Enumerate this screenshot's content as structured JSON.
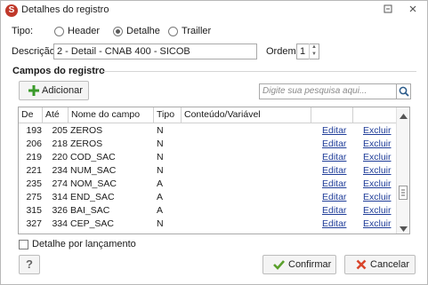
{
  "window": {
    "title": "Detalhes do registro",
    "app_icon_glyph": "S"
  },
  "tipo": {
    "label": "Tipo:",
    "options": [
      "Header",
      "Detalhe",
      "Trailler"
    ],
    "selected": "Detalhe"
  },
  "descricao": {
    "label": "Descrição:",
    "value": "2 - Detail - CNAB 400 - SICOB"
  },
  "ordem": {
    "label": "Ordem:",
    "value": "1"
  },
  "campos": {
    "title": "Campos do registro",
    "add_button": "Adicionar",
    "search_placeholder": "Digite sua pesquisa aqui...",
    "columns": [
      "De",
      "Até",
      "Nome do campo",
      "Tipo",
      "Conteúdo/Variável"
    ],
    "rows": [
      {
        "de": "193",
        "ate": "205",
        "nome": "ZEROS",
        "tipo": "N",
        "conteudo": "",
        "edit": "Editar",
        "delete": "Excluir"
      },
      {
        "de": "206",
        "ate": "218",
        "nome": "ZEROS",
        "tipo": "N",
        "conteudo": "",
        "edit": "Editar",
        "delete": "Excluir"
      },
      {
        "de": "219",
        "ate": "220",
        "nome": "COD_SAC",
        "tipo": "N",
        "conteudo": "",
        "edit": "Editar",
        "delete": "Excluir"
      },
      {
        "de": "221",
        "ate": "234",
        "nome": "NUM_SAC",
        "tipo": "N",
        "conteudo": "",
        "edit": "Editar",
        "delete": "Excluir"
      },
      {
        "de": "235",
        "ate": "274",
        "nome": "NOM_SAC",
        "tipo": "A",
        "conteudo": "",
        "edit": "Editar",
        "delete": "Excluir"
      },
      {
        "de": "275",
        "ate": "314",
        "nome": "END_SAC",
        "tipo": "A",
        "conteudo": "",
        "edit": "Editar",
        "delete": "Excluir"
      },
      {
        "de": "315",
        "ate": "326",
        "nome": "BAI_SAC",
        "tipo": "A",
        "conteudo": "",
        "edit": "Editar",
        "delete": "Excluir"
      },
      {
        "de": "327",
        "ate": "334",
        "nome": "CEP_SAC",
        "tipo": "N",
        "conteudo": "",
        "edit": "Editar",
        "delete": "Excluir"
      }
    ]
  },
  "detalhe_por_lancamento": {
    "label": "Detalhe por lançamento",
    "checked": false
  },
  "footer": {
    "help": "?",
    "confirm": "Confirmar",
    "cancel": "Cancelar"
  },
  "colors": {
    "link": "#1f3d99",
    "add_icon": "#3a9a2a",
    "confirm_icon": "#5aa02c",
    "cancel_icon": "#d9452b",
    "app_icon": "#c0392b"
  }
}
